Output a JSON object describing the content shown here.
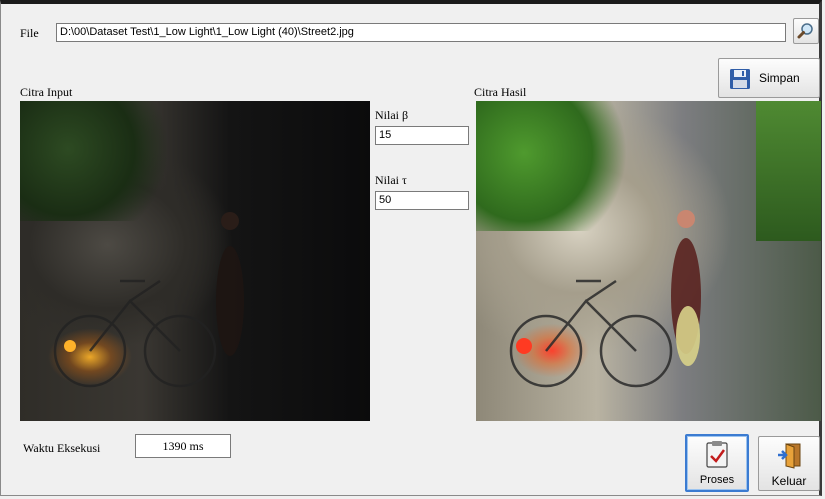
{
  "file": {
    "label": "File",
    "path": "D:\\00\\Dataset Test\\1_Low Light\\1_Low Light (40)\\Street2.jpg"
  },
  "buttons": {
    "simpan": "Simpan",
    "proses": "Proses",
    "keluar": "Keluar"
  },
  "input_image": {
    "label": "Citra Input"
  },
  "output_image": {
    "label": "Citra Hasil"
  },
  "params": {
    "beta_label": "Nilai β",
    "beta_value": "15",
    "tau_label": "Nilai τ",
    "tau_value": "50"
  },
  "execution": {
    "label": "Waktu Eksekusi",
    "value": "1390 ms"
  },
  "icons": {
    "browse": "magnifier-icon",
    "save": "floppy-disk-icon",
    "process": "clipboard-check-icon",
    "exit": "exit-door-icon"
  },
  "colors": {
    "focus_border": "#3b7bd1",
    "window_bg": "#f0f0f0"
  }
}
